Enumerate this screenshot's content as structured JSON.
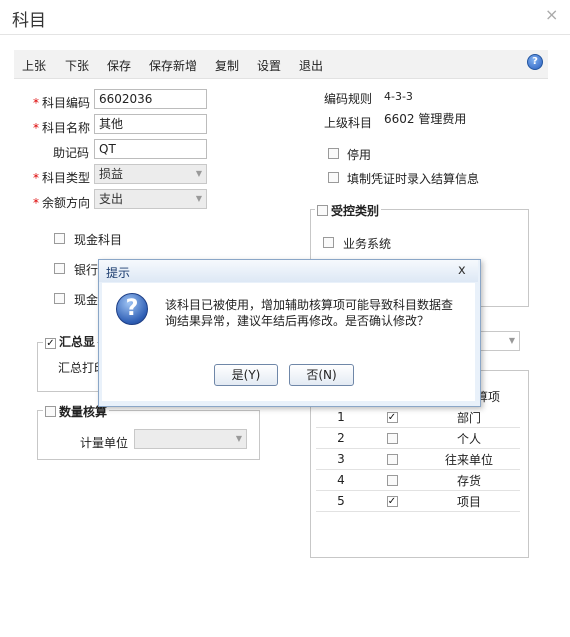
{
  "window": {
    "title": "科目",
    "close": "×"
  },
  "toolbar": {
    "items": [
      "上张",
      "下张",
      "保存",
      "保存新增",
      "复制",
      "设置",
      "退出"
    ],
    "help": "?"
  },
  "form": {
    "code_label": "科目编码",
    "code_value": "6602036",
    "name_label": "科目名称",
    "name_value": "其他",
    "mnemonic_label": "助记码",
    "mnemonic_value": "QT",
    "type_label": "科目类型",
    "type_value": "损益",
    "balance_label": "余额方向",
    "balance_value": "支出",
    "required_mark": "*"
  },
  "right": {
    "rule_label": "编码规则",
    "rule_value": "4-3-3",
    "parent_label": "上级科目",
    "parent_code": "6602",
    "parent_name": "管理费用",
    "disable_label": "停用",
    "settlement_label": "填制凭证时录入结算信息"
  },
  "checks": {
    "cash": "现金科目",
    "bank_partial": "银行",
    "cash_eq_partial": "现金"
  },
  "groups": {
    "control_title": "受控类别",
    "business_system": "业务系统",
    "summary_title_partial": "汇总显",
    "summary_print_partial": "汇总打印",
    "quantity_title": "数量核算",
    "unit_label": "计量单位",
    "aux_header_partial": "算项"
  },
  "aux_items": [
    {
      "no": "1",
      "checked": true,
      "name": "部门"
    },
    {
      "no": "2",
      "checked": false,
      "name": "个人"
    },
    {
      "no": "3",
      "checked": false,
      "name": "往来单位"
    },
    {
      "no": "4",
      "checked": false,
      "name": "存货"
    },
    {
      "no": "5",
      "checked": true,
      "name": "项目"
    }
  ],
  "dialog": {
    "title": "提示",
    "close": "x",
    "message_line1": "该科目已被使用，增加辅助核算项可能导致科目数据查",
    "message_line2": "询结果异常，建议年结后再修改。是否确认修改？",
    "yes": "是(Y)",
    "no": "否(N)"
  }
}
